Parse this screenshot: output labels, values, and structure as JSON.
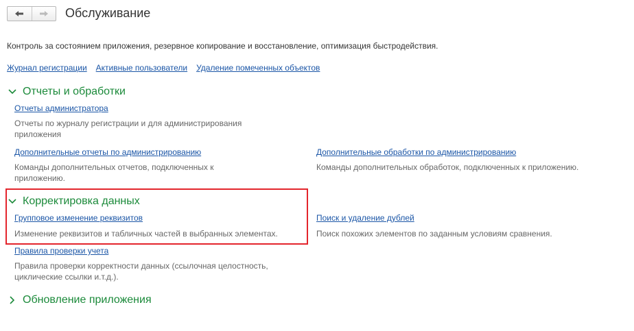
{
  "header": {
    "title": "Обслуживание",
    "description": "Контроль за состоянием приложения, резервное копирование и восстановление, оптимизация быстродействия."
  },
  "top_links": [
    "Журнал регистрации",
    "Активные пользователи",
    "Удаление помеченных объектов"
  ],
  "groups": {
    "reports": {
      "title": "Отчеты и обработки",
      "admin_reports": {
        "label": "Отчеты администратора",
        "desc_line1": "Отчеты по журналу регистрации и для администрирования",
        "desc_line2": "приложения"
      },
      "extra_reports": {
        "label": "Дополнительные отчеты по администрированию",
        "desc_line1": "Команды дополнительных отчетов, подключенных к",
        "desc_line2": "приложению."
      },
      "extra_processing": {
        "label": "Дополнительные обработки по администрированию",
        "desc": "Команды дополнительных обработок, подключенных к приложению."
      }
    },
    "data_correction": {
      "title": "Корректировка данных",
      "group_change": {
        "label": "Групповое изменение реквизитов",
        "desc": "Изменение реквизитов и табличных частей в выбранных элементах."
      },
      "duplicates": {
        "label": "Поиск и удаление дублей",
        "desc": "Поиск похожих элементов по заданным условиям сравнения."
      },
      "check_rules": {
        "label": "Правила проверки учета",
        "desc_line1": "Правила проверки корректности данных (ссылочная целостность,",
        "desc_line2": "циклические ссылки и.т.д.)."
      }
    },
    "app_update": {
      "title": "Обновление приложения"
    }
  },
  "colors": {
    "group_title": "#1b8a3a",
    "link": "#1a55a6",
    "highlight_border": "#e3242b"
  }
}
